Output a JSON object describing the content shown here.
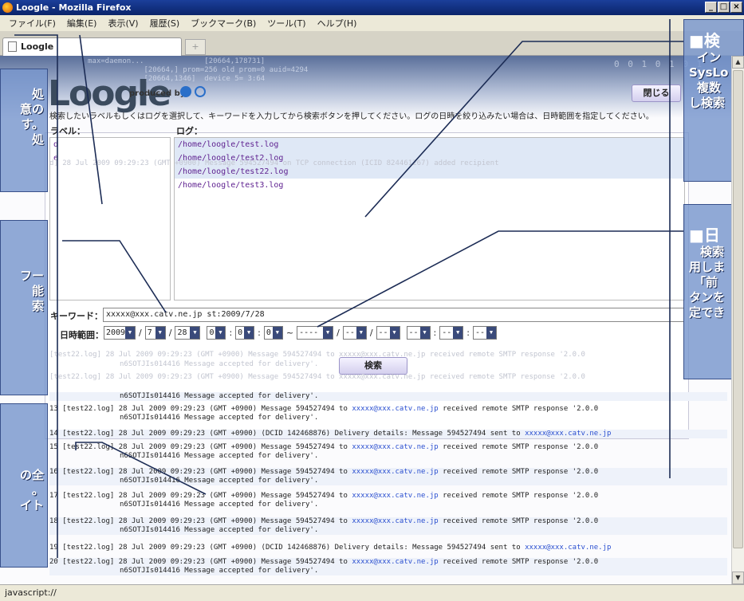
{
  "window": {
    "title": "Loogle - Mozilla Firefox",
    "controls": [
      "_",
      "□",
      "×"
    ]
  },
  "menu": [
    "ファイル(F)",
    "編集(E)",
    "表示(V)",
    "履歴(S)",
    "ブックマーク(B)",
    "ツール(T)",
    "ヘルプ(H)"
  ],
  "tab": {
    "title": "Loogle",
    "new_tab": "+"
  },
  "header": {
    "logo": "Loogle",
    "produced_by": "produced by",
    "close_label": "閉じる",
    "code_lines": "max=daemon...              [20664,178731]\n             [20664,] prom=256 old prom=0 auid=4294\n             [20664,1346]  device 5= 3:64",
    "binary": "0 0 1 0 1 0 1"
  },
  "search": {
    "instruction": "検索したいラベルもしくはログを選択して、キーワードを入力してから検索ボタンを押してください。ログの日時を絞り込みたい場合は、日時範囲を指定してください。",
    "label_header": "ラベル：",
    "log_header": "ログ：",
    "labels": [
      "d",
      "e"
    ],
    "logs": [
      "/home/loogle/test.log",
      "/home/loogle/test2.log",
      "/home/loogle/test22.log",
      "/home/loogle/test3.log"
    ],
    "keyword_label": "キーワード：",
    "keyword_value": "xxxxx@xxx.catv.ne.jp st:2009/7/28",
    "date_label": "日時範囲：",
    "date_from": {
      "year": "2009",
      "month": "7",
      "day": "28",
      "hour": "0",
      "min": "0",
      "sec": "0"
    },
    "tilde": "~",
    "date_to": {
      "year": "----",
      "month": "--",
      "day": "--",
      "hour": "--",
      "min": "--",
      "sec": "--"
    },
    "search_label": "検索"
  },
  "results": [
    {
      "n": "",
      "file": "",
      "text": "n6SOTJIs014416 Message accepted for delivery'.",
      "email": "",
      "cont": ""
    },
    {
      "n": "13",
      "file": "[test22.log]",
      "text": "28 Jul 2009 09:29:23 (GMT +0900) Message 594527494 to ",
      "email": "xxxxx@xxx.catv.ne.jp",
      "tail": " received remote SMTP response '2.0.0",
      "cont": "n6SOTJIs014416 Message accepted for delivery'."
    },
    {
      "n": "14",
      "file": "[test22.log]",
      "text": "28 Jul 2009 09:29:23 (GMT +0900) (DCID 142468876) Delivery details: Message 594527494 sent to ",
      "email": "xxxxx@xxx.catv.ne.jp",
      "tail": "",
      "cont": ""
    },
    {
      "n": "15",
      "file": "[test22.log]",
      "text": "28 Jul 2009 09:29:23 (GMT +0900) Message 594527494 to ",
      "email": "xxxxx@xxx.catv.ne.jp",
      "tail": " received remote SMTP response '2.0.0",
      "cont": "n6SOTJIs014416 Message accepted for delivery'."
    },
    {
      "n": "16",
      "file": "[test22.log]",
      "text": "28 Jul 2009 09:29:23 (GMT +0900) Message 594527494 to ",
      "email": "xxxxx@xxx.catv.ne.jp",
      "tail": " received remote SMTP response '2.0.0",
      "cont": "n6SOTJIs014416 Message accepted for delivery'."
    },
    {
      "n": "17",
      "file": "[test22.log]",
      "text": "28 Jul 2009 09:29:23 (GMT +0900) Message 594527494 to ",
      "email": "xxxxx@xxx.catv.ne.jp",
      "tail": " received remote SMTP response '2.0.0",
      "cont": "n6SOTJIs014416 Message accepted for delivery'."
    },
    {
      "n": "18",
      "file": "[test22.log]",
      "text": "28 Jul 2009 09:29:23 (GMT +0900) Message 594527494 to ",
      "email": "xxxxx@xxx.catv.ne.jp",
      "tail": " received remote SMTP response '2.0.0",
      "cont": "n6SOTJIs014416 Message accepted for delivery'."
    },
    {
      "n": "19",
      "file": "[test22.log]",
      "text": "28 Jul 2009 09:29:23 (GMT +0900) (DCID 142468876) Delivery details: Message 594527494 sent to ",
      "email": "xxxxx@xxx.catv.ne.jp",
      "tail": "",
      "cont": ""
    },
    {
      "n": "20",
      "file": "[test22.log]",
      "text": "28 Jul 2009 09:29:23 (GMT +0900) Message 594527494 to ",
      "email": "xxxxx@xxx.catv.ne.jp",
      "tail": " received remote SMTP response '2.0.0",
      "cont": "n6SOTJIs014416 Message accepted for delivery'."
    }
  ],
  "ghost_lines": [
    "d] 28 Jul 2009 09:29:23 (GMT +0900) Message 594527494 on TCP connection (ICID 824461267) added recipient",
    "[test22.log] 28 Jul 2009 09:29:23 (GMT +0900) Message 594527494 to xxxxx@xxx.catv.ne.jp received remote SMTP response '2.0.0",
    "n6SOTJIs014416 Message accepted for delivery'.",
    "[test22.log] 28 Jul 2009 09:29:23 (GMT +0900) Message 594527494 to xxxxx@xxx.catv.ne.jp received remote SMTP response '2.0.0"
  ],
  "callouts_left": [
    {
      "lines": [
        "処",
        "意の",
        "す。",
        "処"
      ]
    },
    {
      "lines": [
        "フー",
        "能",
        "",
        "索"
      ]
    },
    {
      "lines": [
        "の全",
        "。",
        "イト"
      ]
    }
  ],
  "callouts_right": [
    {
      "head": "■検",
      "lines": [
        "イン",
        "SysLo",
        "複数",
        "し検索"
      ]
    },
    {
      "head": "■日",
      "lines": [
        "検索",
        "用しま",
        "「前",
        "タンを",
        "定でき"
      ]
    }
  ],
  "status": "javascript://"
}
